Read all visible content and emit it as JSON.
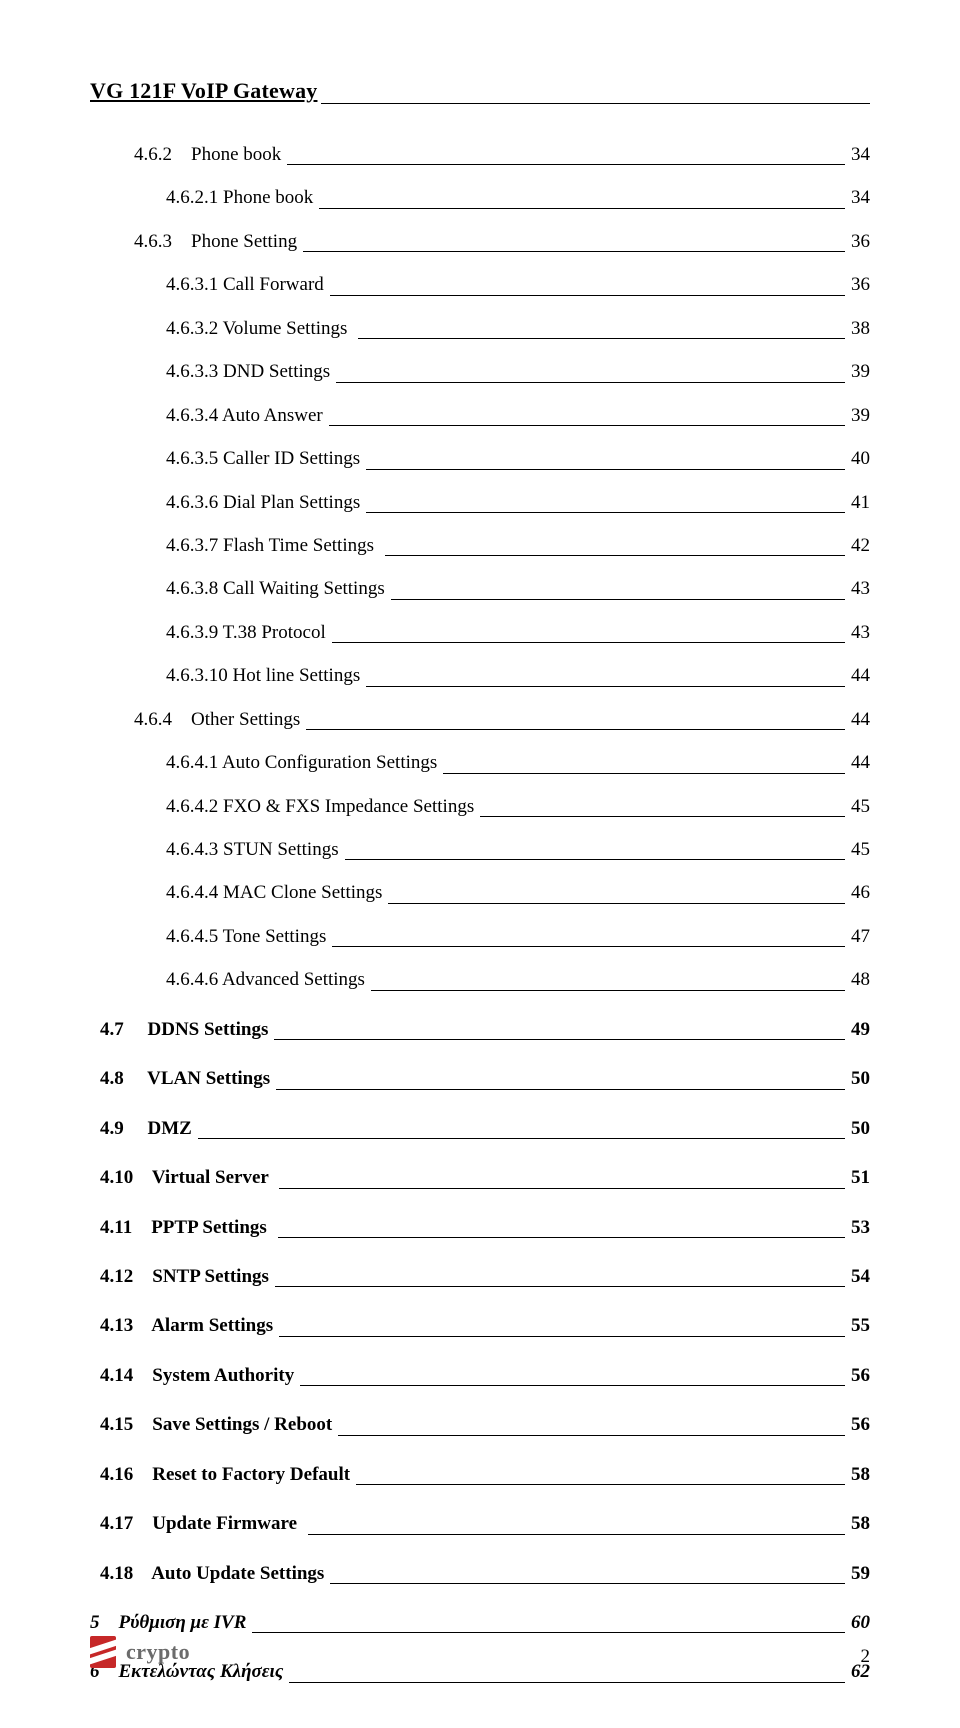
{
  "header": "VG 121F VoIP Gateway",
  "toc": [
    {
      "level": "l2",
      "label": "4.6.2    Phone book",
      "page": "34"
    },
    {
      "level": "l3",
      "label": "4.6.2.1 Phone book",
      "page": "34"
    },
    {
      "level": "l2",
      "label": "4.6.3    Phone Setting",
      "page": "36"
    },
    {
      "level": "l3",
      "label": "4.6.3.1 Call Forward",
      "page": "36"
    },
    {
      "level": "l3",
      "label": "4.6.3.2 Volume Settings ",
      "page": "38"
    },
    {
      "level": "l3",
      "label": "4.6.3.3 DND Settings",
      "page": "39"
    },
    {
      "level": "l3",
      "label": "4.6.3.4 Auto Answer",
      "page": "39"
    },
    {
      "level": "l3",
      "label": "4.6.3.5 Caller ID Settings",
      "page": "40"
    },
    {
      "level": "l3",
      "label": "4.6.3.6 Dial Plan Settings",
      "page": "41"
    },
    {
      "level": "l3",
      "label": "4.6.3.7 Flash Time Settings ",
      "page": "42"
    },
    {
      "level": "l3",
      "label": "4.6.3.8 Call Waiting Settings",
      "page": "43"
    },
    {
      "level": "l3",
      "label": "4.6.3.9 T.38 Protocol",
      "page": "43"
    },
    {
      "level": "l3",
      "label": "4.6.3.10 Hot line Settings",
      "page": "44"
    },
    {
      "level": "l2",
      "label": "4.6.4    Other Settings",
      "page": "44"
    },
    {
      "level": "l3",
      "label": "4.6.4.1 Auto Configuration Settings",
      "page": "44"
    },
    {
      "level": "l3",
      "label": "4.6.4.2 FXO & FXS Impedance Settings",
      "page": "45"
    },
    {
      "level": "l3",
      "label": "4.6.4.3 STUN Settings",
      "page": "45"
    },
    {
      "level": "l3",
      "label": "4.6.4.4 MAC Clone Settings",
      "page": "46"
    },
    {
      "level": "l3",
      "label": "4.6.4.5 Tone Settings",
      "page": "47"
    },
    {
      "level": "l3",
      "label": "4.6.4.6 Advanced Settings",
      "page": "48"
    },
    {
      "level": "l1b",
      "label": "4.7     DDNS Settings",
      "page": "49"
    },
    {
      "level": "l1b",
      "label": "4.8     VLAN Settings",
      "page": "50"
    },
    {
      "level": "l1b",
      "label": "4.9     DMZ",
      "page": "50"
    },
    {
      "level": "l1b",
      "label": "4.10    Virtual Server ",
      "page": "51"
    },
    {
      "level": "l1b",
      "label": "4.11    PPTP Settings ",
      "page": "53"
    },
    {
      "level": "l1b",
      "label": "4.12    SNTP Settings",
      "page": "54"
    },
    {
      "level": "l1b",
      "label": "4.13    Alarm Settings",
      "page": "55"
    },
    {
      "level": "l1b",
      "label": "4.14    System Authority",
      "page": "56"
    },
    {
      "level": "l1b",
      "label": "4.15    Save Settings / Reboot",
      "page": "56"
    },
    {
      "level": "l1b",
      "label": "4.16    Reset to Factory Default",
      "page": "58"
    },
    {
      "level": "l1b",
      "label": "4.17    Update Firmware ",
      "page": "58"
    },
    {
      "level": "l1b",
      "label": "4.18    Auto Update Settings",
      "page": "59"
    },
    {
      "level": "l0b",
      "label": "5    Ρύθμιση με IVR",
      "page": "60"
    },
    {
      "level": "l0b",
      "label": "6    Εκτελώντας Κλήσεις",
      "page": "62"
    }
  ],
  "footer": {
    "logo_text": "crypto",
    "page_number": "2"
  }
}
